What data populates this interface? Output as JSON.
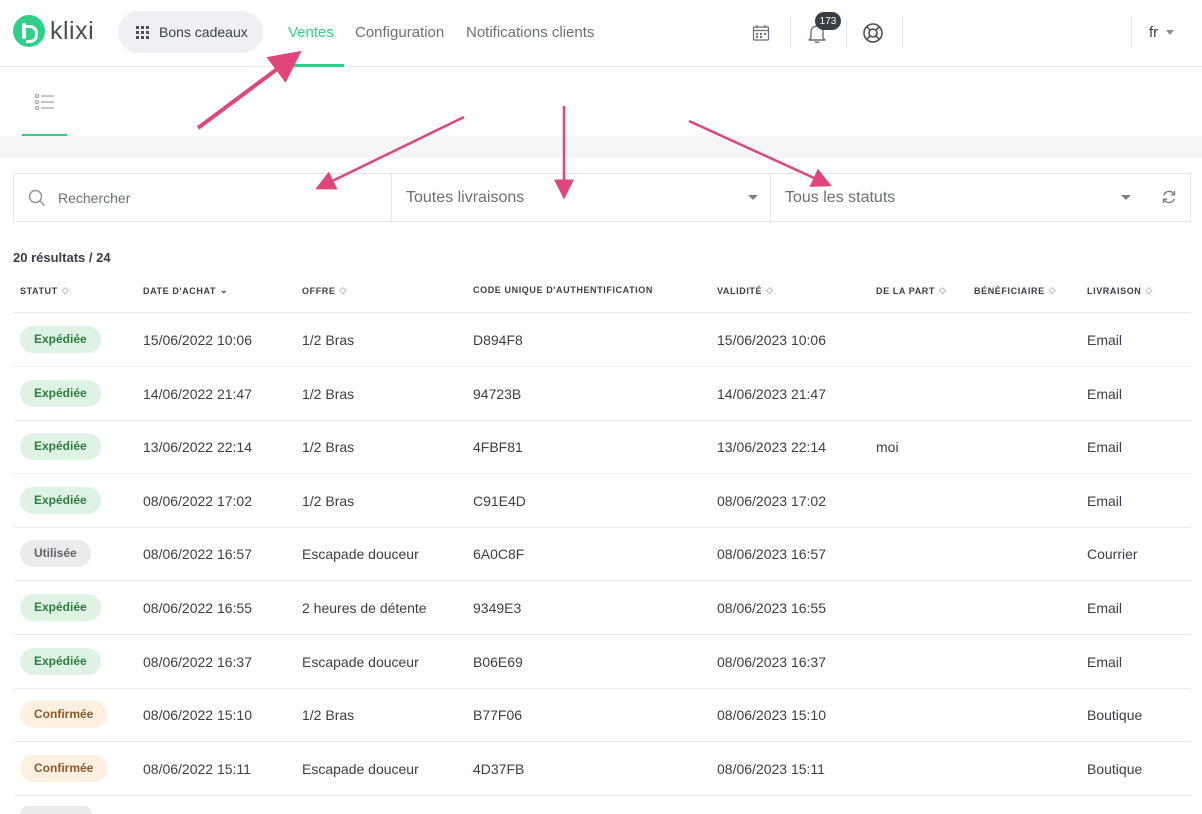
{
  "logo": {
    "text": "klixi"
  },
  "app_switcher": {
    "label": "Bons cadeaux"
  },
  "nav": {
    "tabs": [
      "Ventes",
      "Configuration",
      "Notifications clients"
    ]
  },
  "notifications": {
    "count": "173"
  },
  "language": {
    "current": "fr"
  },
  "filters": {
    "search_placeholder": "Rechercher",
    "delivery_select": "Toutes livraisons",
    "status_select": "Tous les statuts"
  },
  "results_label": "20 résultats / 24",
  "table": {
    "headers": [
      "STATUT",
      "DATE D'ACHAT",
      "OFFRE",
      "CODE UNIQUE D'AUTHENTIFICATION",
      "VALIDITÉ",
      "DE LA PART",
      "BÉNÉFICIAIRE",
      "LIVRAISON"
    ],
    "rows": [
      {
        "status": "Expédiée",
        "status_type": "green",
        "date": "15/06/2022 10:06",
        "offer": "1/2 Bras",
        "code": "D894F8",
        "validity": "15/06/2023 10:06",
        "from": "",
        "beneficiary": "",
        "delivery": "Email"
      },
      {
        "status": "Expédiée",
        "status_type": "green",
        "date": "14/06/2022 21:47",
        "offer": "1/2 Bras",
        "code": "94723B",
        "validity": "14/06/2023 21:47",
        "from": "",
        "beneficiary": "",
        "delivery": "Email"
      },
      {
        "status": "Expédiée",
        "status_type": "green",
        "date": "13/06/2022 22:14",
        "offer": "1/2 Bras",
        "code": "4FBF81",
        "validity": "13/06/2023 22:14",
        "from": "moi",
        "beneficiary": "",
        "delivery": "Email"
      },
      {
        "status": "Expédiée",
        "status_type": "green",
        "date": "08/06/2022 17:02",
        "offer": "1/2 Bras",
        "code": "C91E4D",
        "validity": "08/06/2023 17:02",
        "from": "",
        "beneficiary": "",
        "delivery": "Email"
      },
      {
        "status": "Utilisée",
        "status_type": "gray",
        "date": "08/06/2022 16:57",
        "offer": "Escapade douceur",
        "code": "6A0C8F",
        "validity": "08/06/2023 16:57",
        "from": "",
        "beneficiary": "",
        "delivery": "Courrier"
      },
      {
        "status": "Expédiée",
        "status_type": "green",
        "date": "08/06/2022 16:55",
        "offer": "2 heures de détente",
        "code": "9349E3",
        "validity": "08/06/2023 16:55",
        "from": "",
        "beneficiary": "",
        "delivery": "Email"
      },
      {
        "status": "Expédiée",
        "status_type": "green",
        "date": "08/06/2022 16:37",
        "offer": "Escapade douceur",
        "code": "B06E69",
        "validity": "08/06/2023 16:37",
        "from": "",
        "beneficiary": "",
        "delivery": "Email"
      },
      {
        "status": "Confirmée",
        "status_type": "orange",
        "date": "08/06/2022 15:10",
        "offer": "1/2 Bras",
        "code": "B77F06",
        "validity": "08/06/2023 15:10",
        "from": "",
        "beneficiary": "",
        "delivery": "Boutique"
      },
      {
        "status": "Confirmée",
        "status_type": "orange",
        "date": "08/06/2022 15:11",
        "offer": "Escapade douceur",
        "code": "4D37FB",
        "validity": "08/06/2023 15:11",
        "from": "",
        "beneficiary": "",
        "delivery": "Boutique"
      }
    ]
  },
  "colors": {
    "accent": "#2fd08a",
    "annotation_arrow": "#e0457b",
    "status_green_bg": "#dff3e4",
    "status_gray_bg": "#ebebeb",
    "status_orange_bg": "#fdf0e0"
  },
  "icons": [
    "grid-icon",
    "calendar-icon",
    "bell-icon",
    "lifebuoy-icon",
    "list-icon",
    "search-icon",
    "chevron-down-icon",
    "refresh-icon"
  ]
}
